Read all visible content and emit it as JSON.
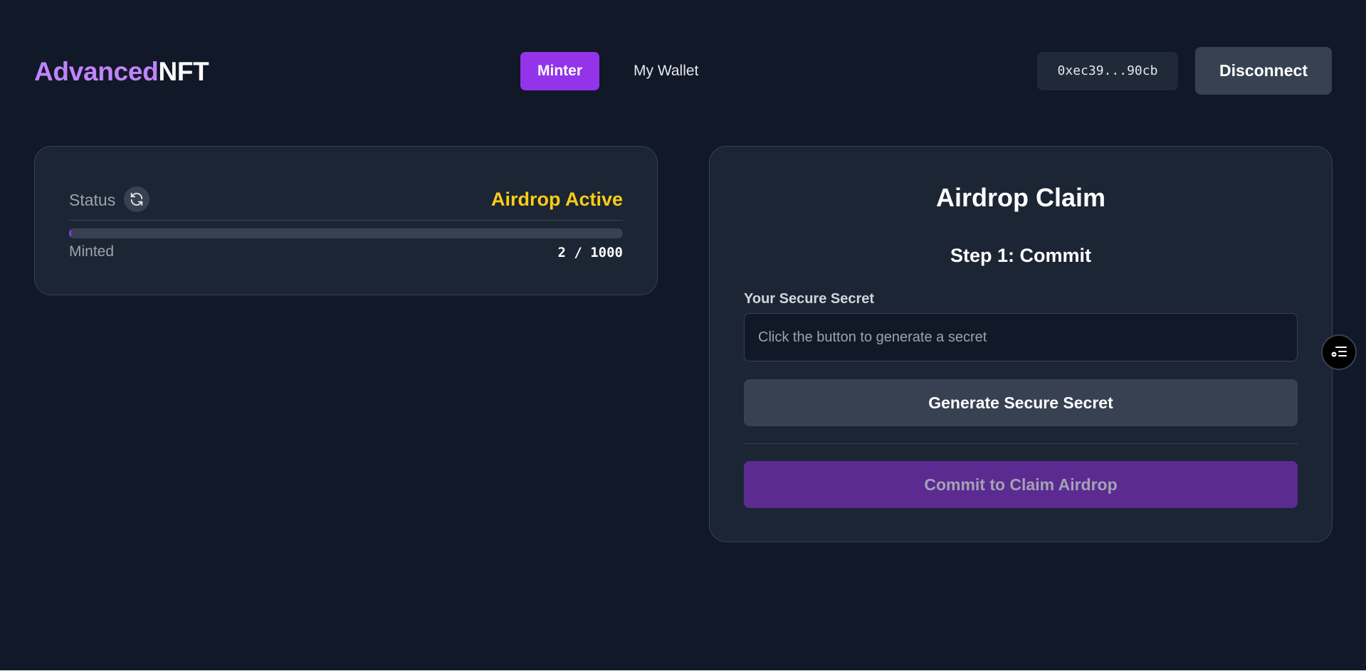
{
  "header": {
    "logo_part1": "Advanced",
    "logo_part2": "NFT",
    "nav": [
      {
        "label": "Minter",
        "active": true
      },
      {
        "label": "My Wallet",
        "active": false
      }
    ],
    "wallet_address": "0xec39...90cb",
    "disconnect_label": "Disconnect"
  },
  "status_card": {
    "label": "Status",
    "refresh_icon": "refresh-icon",
    "value": "Airdrop Active",
    "value_color": "#facc15",
    "progress_fraction": 0.002,
    "minted_label": "Minted",
    "minted_count": "2 / 1000"
  },
  "airdrop_card": {
    "title": "Airdrop Claim",
    "step_title": "Step 1: Commit",
    "secret_label": "Your Secure Secret",
    "secret_value": "",
    "secret_placeholder": "Click the button to generate a secret",
    "generate_label": "Generate Secure Secret",
    "commit_label": "Commit to Claim Airdrop",
    "commit_disabled": true
  },
  "floating_widget": {
    "icon": "list-icon"
  },
  "colors": {
    "background": "#111827",
    "accent": "#9333ea",
    "logo_accent": "#c084fc",
    "card": "#1c2533"
  }
}
